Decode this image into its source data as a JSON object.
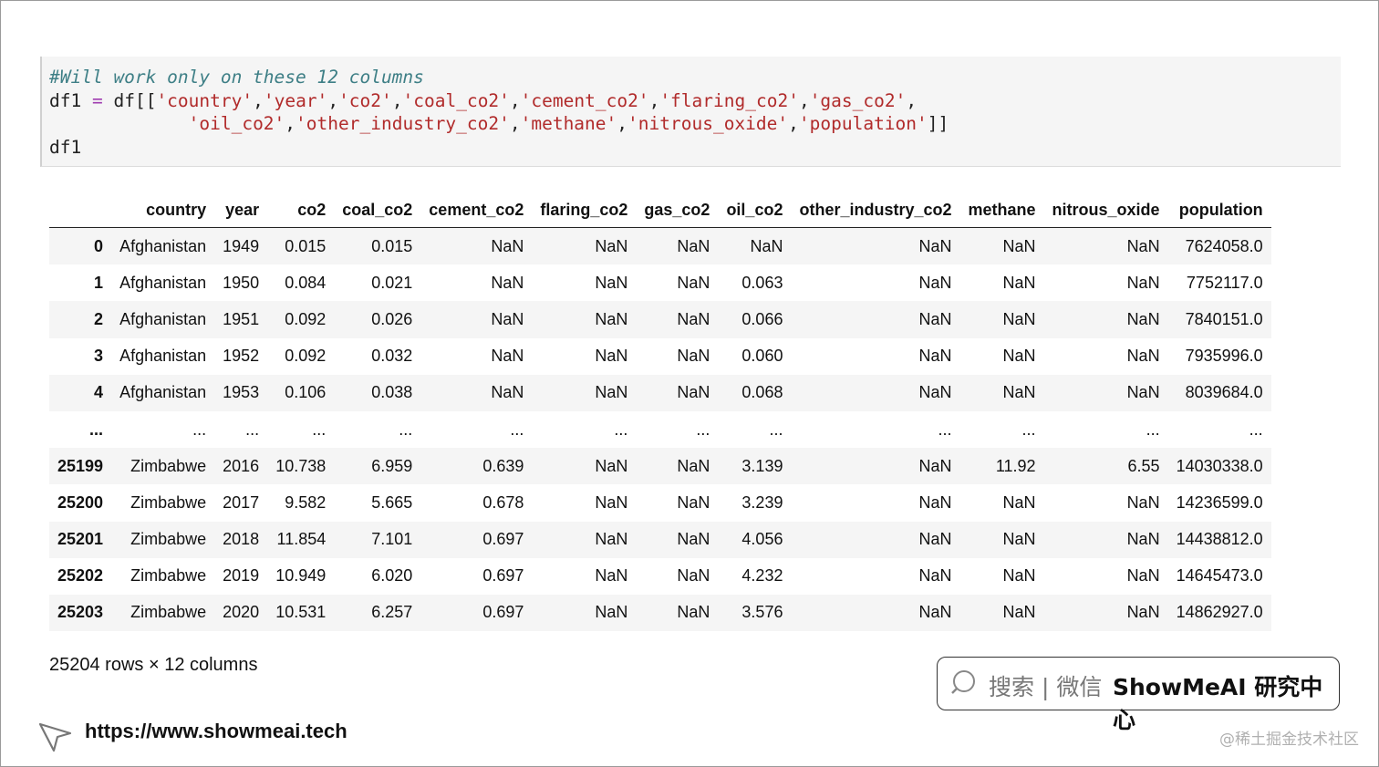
{
  "code": {
    "comment": "#Will work only on these 12 columns",
    "var": "df1",
    "assign": " = ",
    "call_open": "df[[",
    "line1_strings": [
      "'country'",
      "'year'",
      "'co2'",
      "'coal_co2'",
      "'cement_co2'",
      "'flaring_co2'",
      "'gas_co2'"
    ],
    "line2_strings": [
      "'oil_co2'",
      "'other_industry_co2'",
      "'methane'",
      "'nitrous_oxide'",
      "'population'"
    ],
    "call_close": "]]",
    "last_line": "df1"
  },
  "table": {
    "headers": [
      "",
      "country",
      "year",
      "co2",
      "coal_co2",
      "cement_co2",
      "flaring_co2",
      "gas_co2",
      "oil_co2",
      "other_industry_co2",
      "methane",
      "nitrous_oxide",
      "population"
    ],
    "rows": [
      [
        "0",
        "Afghanistan",
        "1949",
        "0.015",
        "0.015",
        "NaN",
        "NaN",
        "NaN",
        "NaN",
        "NaN",
        "NaN",
        "NaN",
        "7624058.0"
      ],
      [
        "1",
        "Afghanistan",
        "1950",
        "0.084",
        "0.021",
        "NaN",
        "NaN",
        "NaN",
        "0.063",
        "NaN",
        "NaN",
        "NaN",
        "7752117.0"
      ],
      [
        "2",
        "Afghanistan",
        "1951",
        "0.092",
        "0.026",
        "NaN",
        "NaN",
        "NaN",
        "0.066",
        "NaN",
        "NaN",
        "NaN",
        "7840151.0"
      ],
      [
        "3",
        "Afghanistan",
        "1952",
        "0.092",
        "0.032",
        "NaN",
        "NaN",
        "NaN",
        "0.060",
        "NaN",
        "NaN",
        "NaN",
        "7935996.0"
      ],
      [
        "4",
        "Afghanistan",
        "1953",
        "0.106",
        "0.038",
        "NaN",
        "NaN",
        "NaN",
        "0.068",
        "NaN",
        "NaN",
        "NaN",
        "8039684.0"
      ],
      [
        "...",
        "...",
        "...",
        "...",
        "...",
        "...",
        "...",
        "...",
        "...",
        "...",
        "...",
        "...",
        "..."
      ],
      [
        "25199",
        "Zimbabwe",
        "2016",
        "10.738",
        "6.959",
        "0.639",
        "NaN",
        "NaN",
        "3.139",
        "NaN",
        "11.92",
        "6.55",
        "14030338.0"
      ],
      [
        "25200",
        "Zimbabwe",
        "2017",
        "9.582",
        "5.665",
        "0.678",
        "NaN",
        "NaN",
        "3.239",
        "NaN",
        "NaN",
        "NaN",
        "14236599.0"
      ],
      [
        "25201",
        "Zimbabwe",
        "2018",
        "11.854",
        "7.101",
        "0.697",
        "NaN",
        "NaN",
        "4.056",
        "NaN",
        "NaN",
        "NaN",
        "14438812.0"
      ],
      [
        "25202",
        "Zimbabwe",
        "2019",
        "10.949",
        "6.020",
        "0.697",
        "NaN",
        "NaN",
        "4.232",
        "NaN",
        "NaN",
        "NaN",
        "14645473.0"
      ],
      [
        "25203",
        "Zimbabwe",
        "2020",
        "10.531",
        "6.257",
        "0.697",
        "NaN",
        "NaN",
        "3.576",
        "NaN",
        "NaN",
        "NaN",
        "14862927.0"
      ]
    ],
    "shape_text": "25204 rows × 12 columns"
  },
  "badge": {
    "icon": "search-icon",
    "text": "搜索 | 微信",
    "brand": "ShowMeAI 研究中心"
  },
  "footer": {
    "url": "https://www.showmeai.tech",
    "watermark": "@稀土掘金技术社区"
  }
}
